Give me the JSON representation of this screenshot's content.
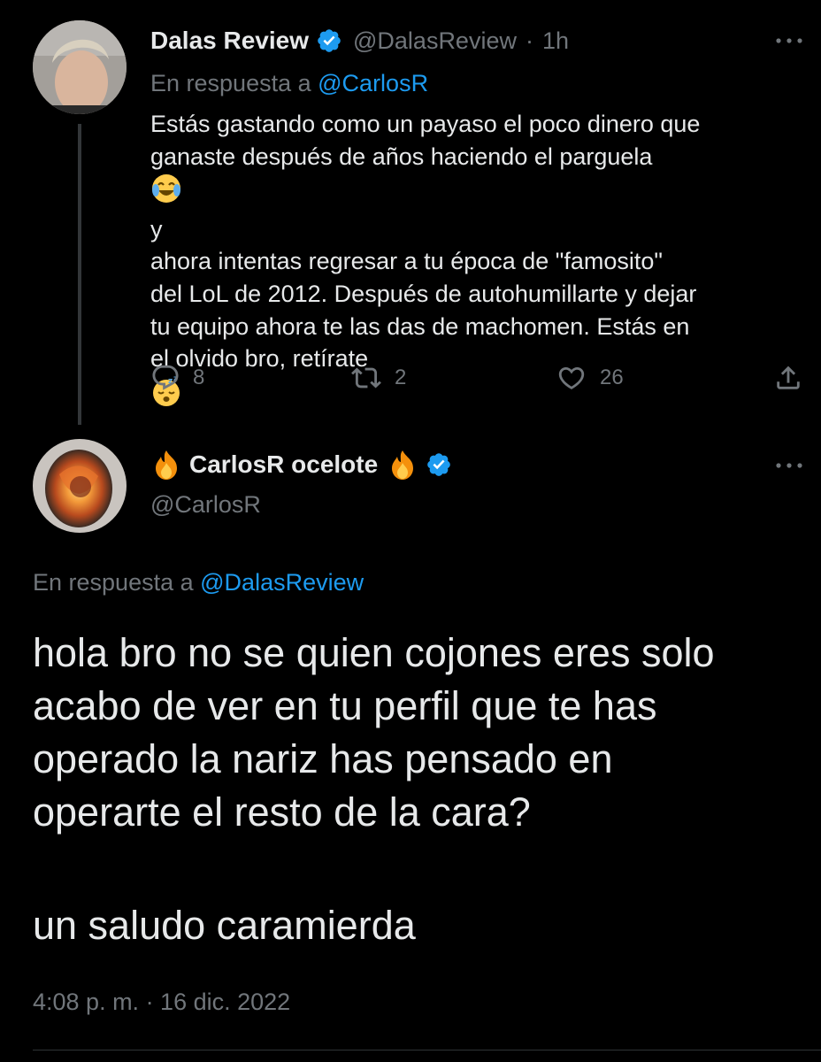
{
  "tweet1": {
    "name": "Dalas Review",
    "handle": "@DalasReview",
    "separator": "·",
    "time": "1h",
    "reply_prefix": "En respuesta a",
    "reply_mention": "@CarlosR",
    "lines": [
      "Estás gastando como un payaso el poco dinero que",
      "ganaste después de años haciendo el parguela",
      "ahora intentas regresar a tu época de \"famosito\"",
      "del LoL de 2012. Después de autohumillarte y dejar",
      "tu equipo ahora te las das de machomen. Estás en",
      "el olvido bro, retírate"
    ],
    "line2_suffix": "y",
    "emoji_laugh": "face-with-tears-of-joy-emoji",
    "emoji_sleep": "sleeping-face-emoji",
    "replies": "8",
    "retweets": "2",
    "likes": "26"
  },
  "tweet2": {
    "name": "CarlosR ocelote",
    "handle": "@CarlosR",
    "name_emoji": "fire-emoji",
    "reply_prefix": "En respuesta a",
    "reply_mention": "@DalasReview",
    "lines": [
      "hola bro no se quien cojones eres solo",
      "acabo de ver en tu perfil que te has",
      "operado la nariz has pensado en",
      "operarte el resto de la cara?"
    ],
    "closing": "un saludo caramierda",
    "timestamp": "4:08 p. m. · 16 dic. 2022"
  },
  "colors": {
    "background": "#000000",
    "text": "#e7e9ea",
    "muted": "#71767b",
    "accent": "#1d9bf0",
    "verified": "#1d9bf0"
  }
}
